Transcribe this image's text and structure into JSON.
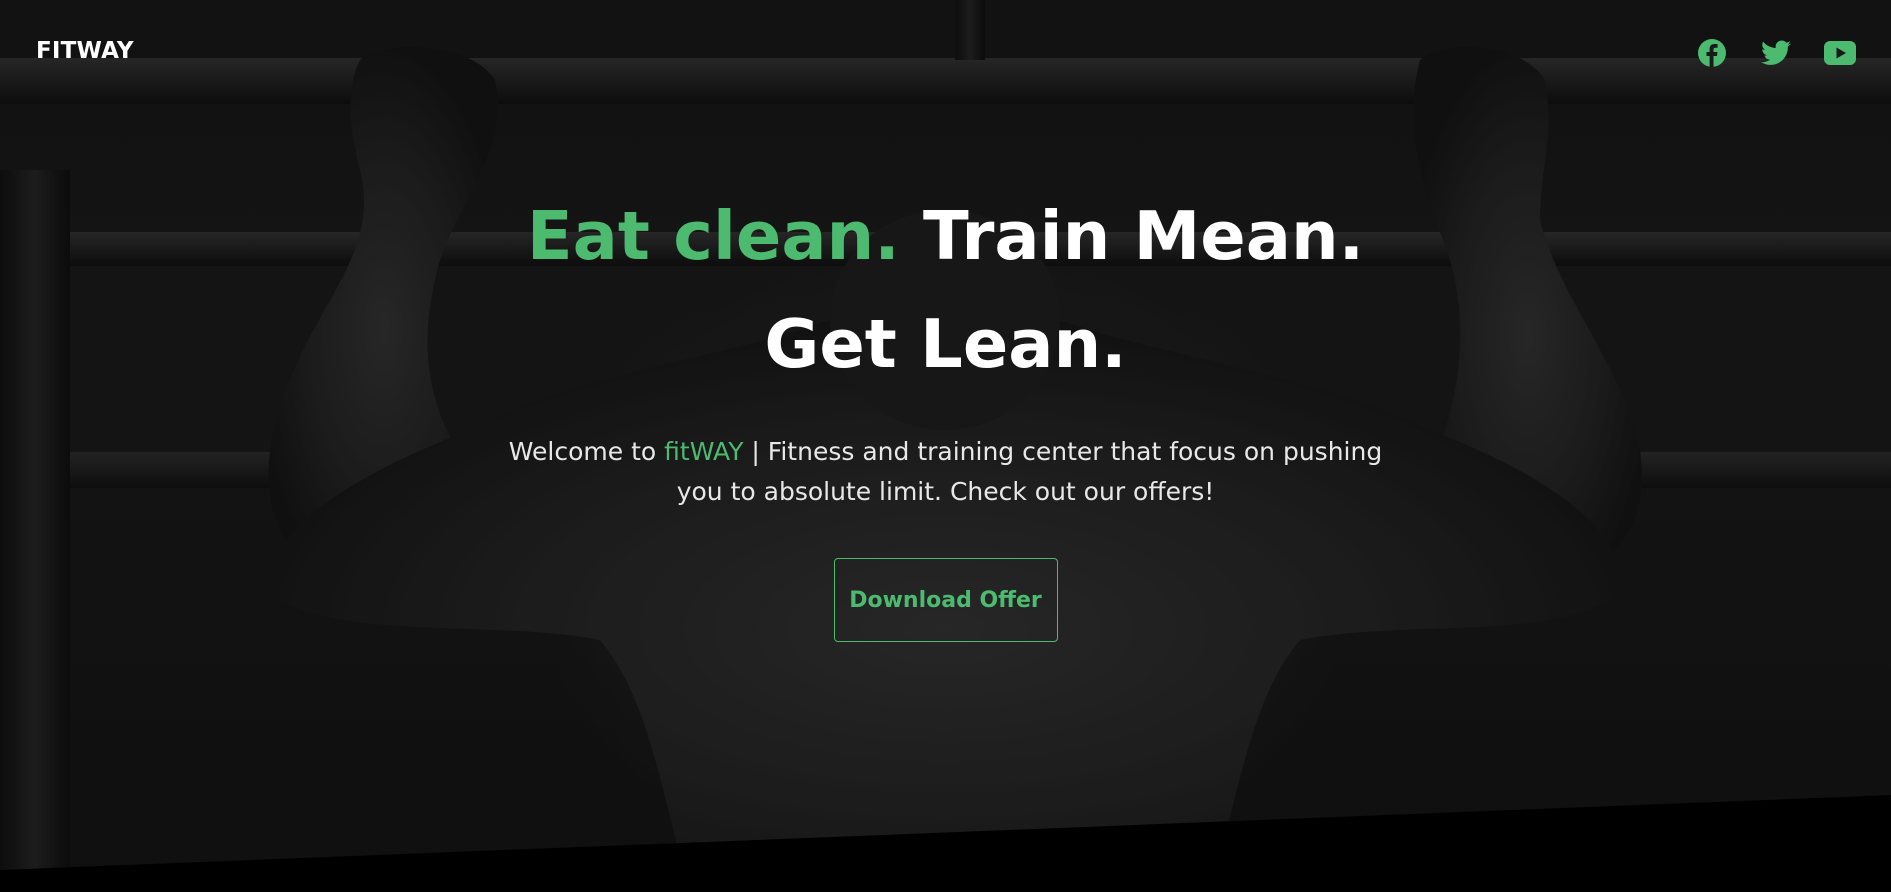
{
  "header": {
    "brand": "FITWAY",
    "social": [
      {
        "icon": "facebook-icon"
      },
      {
        "icon": "twitter-icon"
      },
      {
        "icon": "youtube-icon"
      }
    ]
  },
  "hero": {
    "headline_accent": "Eat clean.",
    "headline_rest": "Train Mean. Get Lean.",
    "sub_prefix": "Welcome to ",
    "sub_brand": "fitWAY",
    "sub_rest": " | Fitness and training center that focus on pushing you to absolute limit. Check out our offers!",
    "cta_label": "Download Offer"
  },
  "colors": {
    "accent": "#4cba6f",
    "text": "#ffffff",
    "background": "#000000"
  }
}
